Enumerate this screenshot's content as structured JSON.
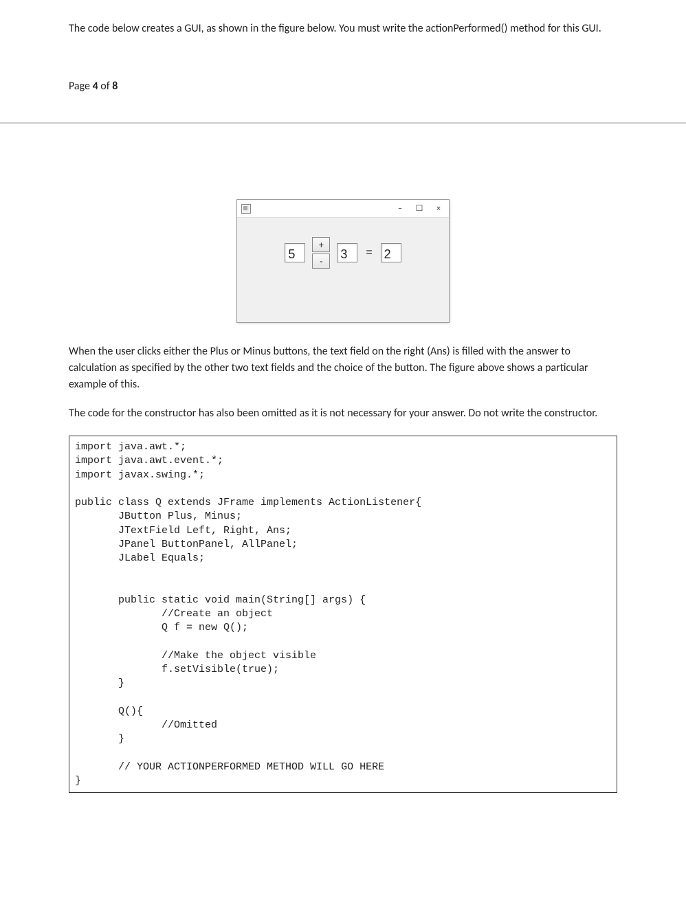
{
  "intro_text": "The code below creates a GUI, as shown in the figure below. You must write the actionPerformed() method for this GUI.",
  "page_num_prefix": "Page ",
  "page_num_current": "4",
  "page_num_mid": " of ",
  "page_num_total": "8",
  "gui": {
    "minimize": "–",
    "maximize": "☐",
    "close": "×",
    "left_value": "5",
    "right_value": "3",
    "ans_value": "2",
    "plus_label": "+",
    "minus_label": "-",
    "equals_label": "="
  },
  "para2": "When the user clicks either the Plus or Minus buttons, the text field on the right (Ans) is filled with the answer to calculation as specified by the other two text fields and the choice of the button. The figure above shows a particular example of this.",
  "para3": "The code for the constructor has also been omitted as it is not necessary for your answer. Do not write the constructor.",
  "code": "import java.awt.*;\nimport java.awt.event.*;\nimport javax.swing.*;\n\npublic class Q extends JFrame implements ActionListener{\n       JButton Plus, Minus;\n       JTextField Left, Right, Ans;\n       JPanel ButtonPanel, AllPanel;\n       JLabel Equals;\n\n\n       public static void main(String[] args) {\n              //Create an object\n              Q f = new Q();\n\n              //Make the object visible\n              f.setVisible(true);\n       }\n\n       Q(){\n              //Omitted\n       }\n\n       // YOUR ACTIONPERFORMED METHOD WILL GO HERE\n}"
}
